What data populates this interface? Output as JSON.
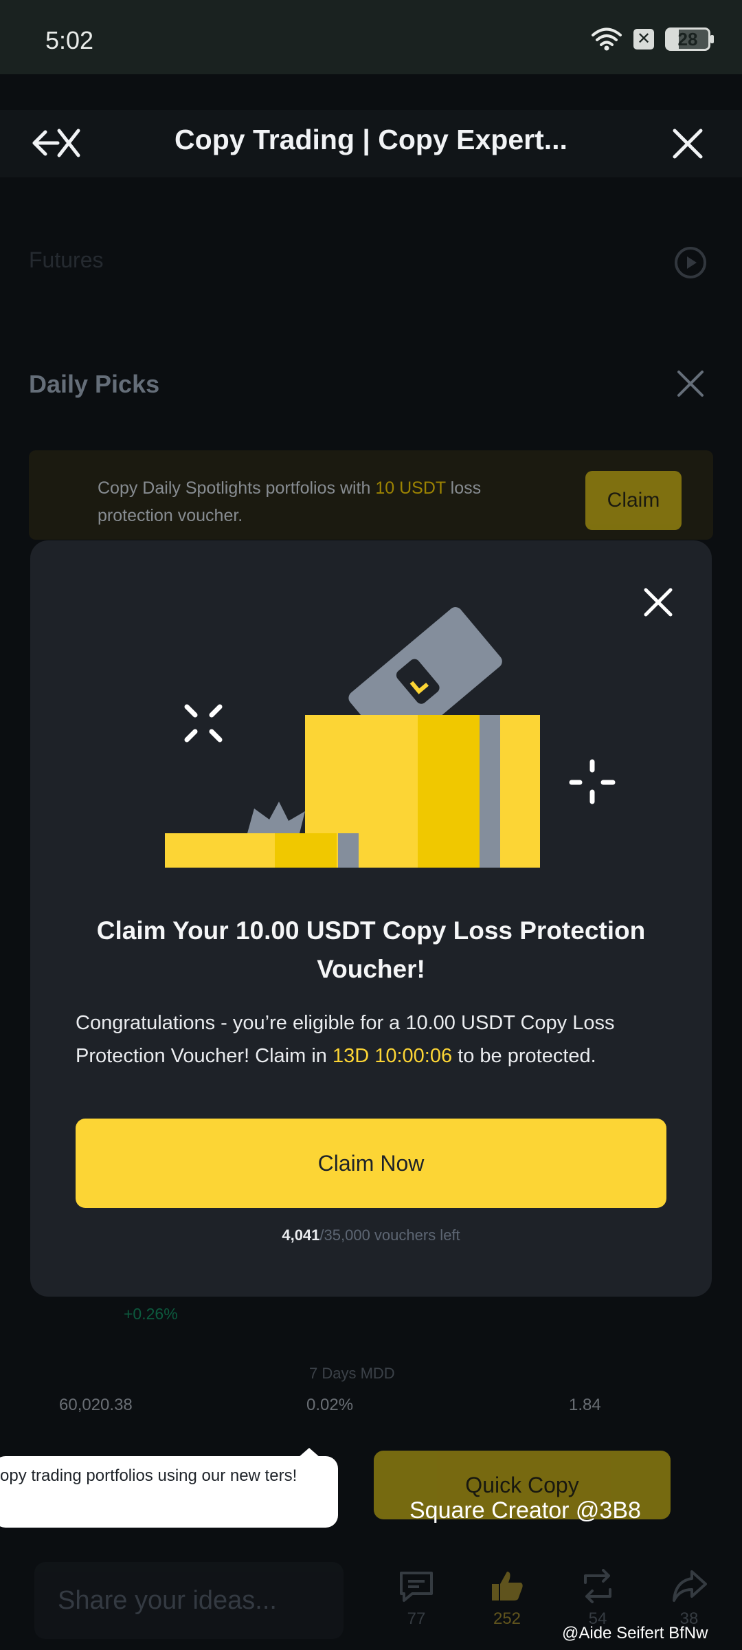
{
  "status_bar": {
    "time": "5:02",
    "battery": "28"
  },
  "nav": {
    "title": "Copy Trading | Copy Expert..."
  },
  "background": {
    "futures_label": "Futures",
    "daily_picks_label": "Daily Picks",
    "banner": {
      "text_before": "Copy Daily Spotlights portfolios with ",
      "highlight": "10 USDT",
      "text_after": " loss protection voucher.",
      "claim_label": "Claim"
    },
    "change_value": "+0.26%",
    "mdd_label": "7 Days MDD",
    "stats": [
      "60,020.38",
      "0.02%",
      "1.84"
    ],
    "quick_copy_label": "Quick Copy",
    "tooltip_text": "opy trading portfolios using our new ters!",
    "share_placeholder": "Share your ideas...",
    "actions": [
      {
        "icon": "comment-icon",
        "count": "77"
      },
      {
        "icon": "like-icon",
        "count": "252"
      },
      {
        "icon": "repost-icon",
        "count": "54"
      },
      {
        "icon": "share-icon",
        "count": "38"
      }
    ],
    "watermark_main": "Square Creator @3B8",
    "watermark_footer": "@Aide Seifert BfNw"
  },
  "modal": {
    "title": "Claim Your 10.00 USDT Copy Loss Protection Voucher!",
    "body_before": "Congratulations - you’re eligible for a 10.00 USDT Copy Loss Protection Voucher! Claim in ",
    "countdown": "13D 10:00:06",
    "body_after": " to be protected.",
    "cta_label": "Claim Now",
    "vouchers_left": "4,041",
    "vouchers_total": "/35,000 vouchers left"
  },
  "colors": {
    "accent": "#fcd535",
    "modal_bg": "#1e2228",
    "page_bg": "#0b0e11"
  }
}
